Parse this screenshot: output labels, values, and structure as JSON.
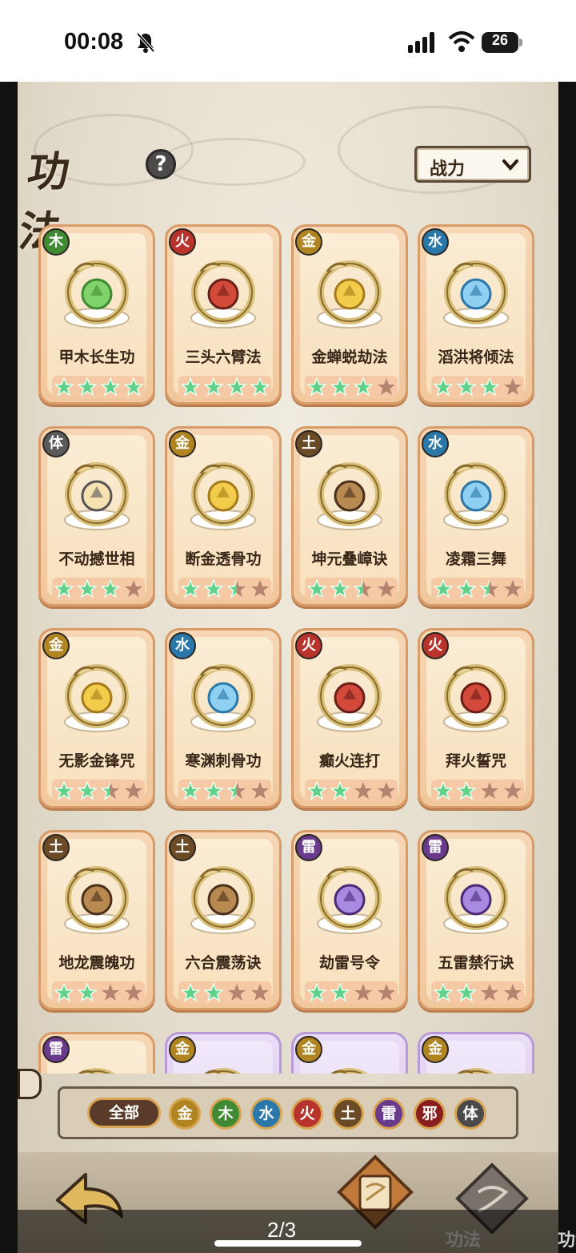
{
  "status_bar": {
    "time": "00:08",
    "battery": "26"
  },
  "header": {
    "title": "功法",
    "help": "?"
  },
  "sort": {
    "label": "战力"
  },
  "cards": [
    {
      "element": "木",
      "name": "甲木长生功",
      "stars": 4,
      "art": "green",
      "frame": "orange"
    },
    {
      "element": "火",
      "name": "三头六臂法",
      "stars": 4,
      "art": "red",
      "frame": "orange"
    },
    {
      "element": "金",
      "name": "金蝉蜕劫法",
      "stars": 3,
      "art": "gold",
      "frame": "orange"
    },
    {
      "element": "水",
      "name": "滔洪将倾法",
      "stars": 3,
      "art": "blue",
      "frame": "orange"
    },
    {
      "element": "体",
      "name": "不动撼世相",
      "stars": 3,
      "art": "cream",
      "frame": "orange"
    },
    {
      "element": "金",
      "name": "断金透骨功",
      "stars": 2.5,
      "art": "gold",
      "frame": "orange"
    },
    {
      "element": "土",
      "name": "坤元叠嶂诀",
      "stars": 2.5,
      "art": "brown",
      "frame": "orange"
    },
    {
      "element": "水",
      "name": "凌霜三舞",
      "stars": 2.5,
      "art": "blue",
      "frame": "orange"
    },
    {
      "element": "金",
      "name": "无影金锋咒",
      "stars": 2.5,
      "art": "gold",
      "frame": "orange"
    },
    {
      "element": "水",
      "name": "寒渊刺骨功",
      "stars": 2.5,
      "art": "blue",
      "frame": "orange"
    },
    {
      "element": "火",
      "name": "癫火连打",
      "stars": 2,
      "art": "red",
      "frame": "orange"
    },
    {
      "element": "火",
      "name": "拜火誓咒",
      "stars": 2,
      "art": "red",
      "frame": "orange"
    },
    {
      "element": "土",
      "name": "地龙震魄功",
      "stars": 2,
      "art": "brown",
      "frame": "orange"
    },
    {
      "element": "土",
      "name": "六合震荡诀",
      "stars": 2,
      "art": "brown",
      "frame": "orange"
    },
    {
      "element": "雷",
      "name": "劫雷号令",
      "stars": 2,
      "art": "purple",
      "frame": "orange"
    },
    {
      "element": "雷",
      "name": "五雷禁行诀",
      "stars": 2,
      "art": "purple",
      "frame": "orange"
    },
    {
      "element": "雷",
      "name": "",
      "stars": 0,
      "art": "purple",
      "frame": "orange"
    },
    {
      "element": "金",
      "name": "",
      "stars": 0,
      "art": "gold",
      "frame": "purple"
    },
    {
      "element": "金",
      "name": "",
      "stars": 0,
      "art": "gold",
      "frame": "purple"
    },
    {
      "element": "金",
      "name": "",
      "stars": 0,
      "art": "gold",
      "frame": "purple"
    }
  ],
  "filters": {
    "all": "全部",
    "elements": [
      {
        "label": "金",
        "color": "#b08420"
      },
      {
        "label": "木",
        "color": "#3f8a32"
      },
      {
        "label": "水",
        "color": "#2a77a9"
      },
      {
        "label": "火",
        "color": "#b8332c"
      },
      {
        "label": "土",
        "color": "#6b4a26"
      },
      {
        "label": "雷",
        "color": "#6a3a8c"
      },
      {
        "label": "邪",
        "color": "#8a1e1e"
      },
      {
        "label": "体",
        "color": "#4a4a4a"
      }
    ]
  },
  "bottom_nav": {
    "tab1": "功法",
    "tab2": "功法组合"
  },
  "pager": "2/3",
  "colors": {
    "star_on": "#5fd18a",
    "star_off": "#b48470",
    "card_frame": "#d99b68"
  }
}
